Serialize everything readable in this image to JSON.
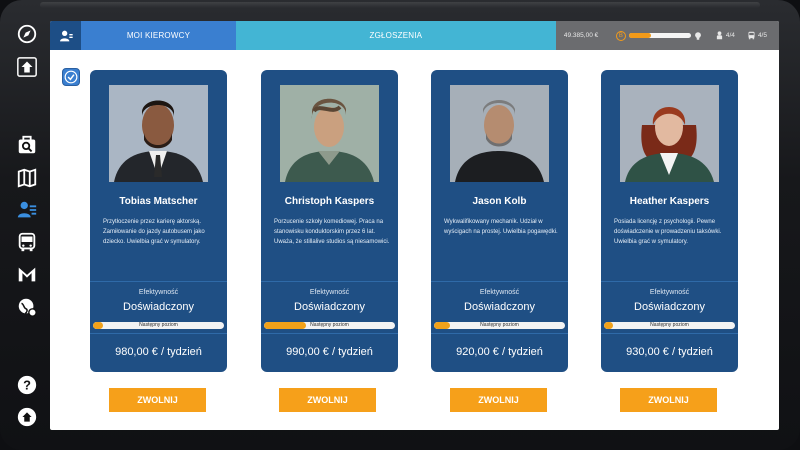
{
  "tabs": {
    "drivers": "MOI KIEROWCY",
    "applications": "ZGŁOSZENIA"
  },
  "status": {
    "money": "49.385,00 €",
    "level_progress": 0.35,
    "drivers_count": "4/4",
    "buses_count": "4/5"
  },
  "colors": {
    "accent_blue": "#3a7fd0",
    "cyan": "#43b5d4",
    "card": "#1f4f84",
    "orange": "#f6a01a"
  },
  "sidebar_icons": [
    "compass-icon",
    "settings-icon",
    "search-icon",
    "map-icon",
    "drivers-icon",
    "bus-icon",
    "mail-icon",
    "globe-icon",
    "help-icon",
    "home-icon"
  ],
  "drivers": [
    {
      "name": "Tobias Matscher",
      "description": "Przytłoczenie przez karierę aktorską. Zamiłowanie do jazdy autobusem jako dziecko. Uwielbia grać w symulatory.",
      "efficiency_label": "Efektywność",
      "efficiency": "Doświadczony",
      "next_level": "Następny poziom",
      "progress": 0.08,
      "salary": "980,00 € / tydzień",
      "fire": "ZWOLNIJ"
    },
    {
      "name": "Christoph Kaspers",
      "description": "Porzucenie szkoły komediowej. Praca na stanowisku konduktorskim przez 6 lat. Uważa, że stillalive studios są niesamowici.",
      "efficiency_label": "Efektywność",
      "efficiency": "Doświadczony",
      "next_level": "Następny poziom",
      "progress": 0.32,
      "salary": "990,00 € / tydzień",
      "fire": "ZWOLNIJ"
    },
    {
      "name": "Jason Kolb",
      "description": "Wykwalifikowany mechanik. Udział w wyścigach na prostej. Uwielbia pogawędki.",
      "efficiency_label": "Efektywność",
      "efficiency": "Doświadczony",
      "next_level": "Następny poziom",
      "progress": 0.12,
      "salary": "920,00 € / tydzień",
      "fire": "ZWOLNIJ"
    },
    {
      "name": "Heather Kaspers",
      "description": "Posiada licencję z psychologii. Pewne doświadczenie w prowadzeniu taksówki. Uwielbia grać w symulatory.",
      "efficiency_label": "Efektywność",
      "efficiency": "Doświadczony",
      "next_level": "Następny poziom",
      "progress": 0.07,
      "salary": "930,00 € / tydzień",
      "fire": "ZWOLNIJ"
    }
  ]
}
